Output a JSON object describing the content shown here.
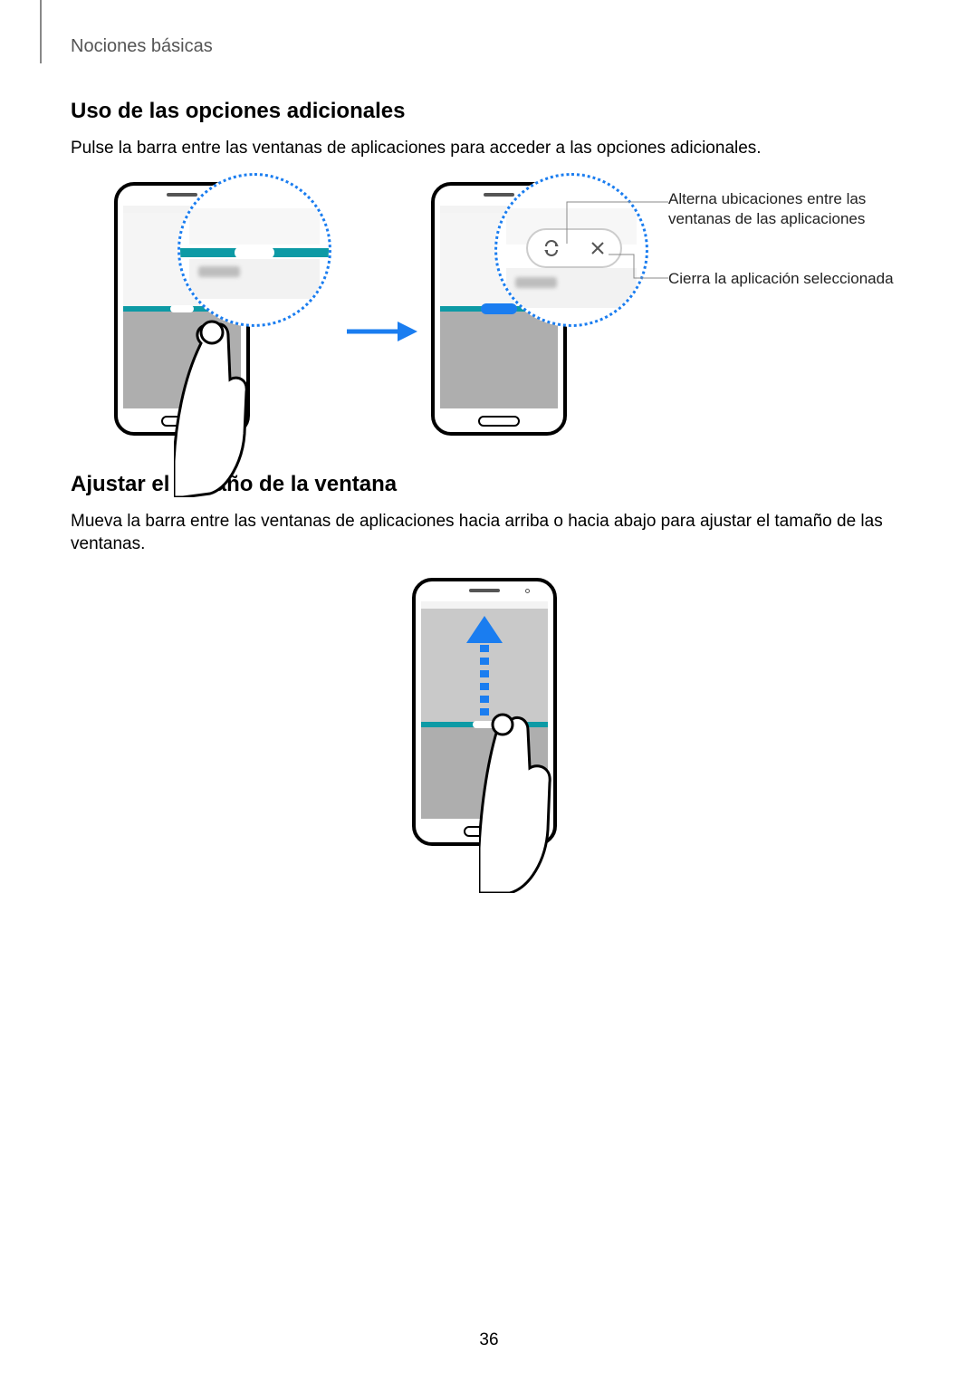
{
  "header": {
    "breadcrumb": "Nociones básicas"
  },
  "section1": {
    "heading": "Uso de las opciones adicionales",
    "body": "Pulse la barra entre las ventanas de aplicaciones para acceder a las opciones adicionales."
  },
  "callouts": {
    "swap": "Alterna ubicaciones entre las ventanas de las aplicaciones",
    "close": "Cierra la aplicación seleccionada"
  },
  "icons": {
    "swap": "swap-icon",
    "close": "close-icon",
    "arrow_right": "arrow-right-icon",
    "arrow_up": "arrow-up-icon"
  },
  "section2": {
    "heading": "Ajustar el tamaño de la ventana",
    "body": "Mueva la barra entre las ventanas de aplicaciones hacia arriba o hacia abajo para ajustar el tamaño de las ventanas."
  },
  "page_number": "36"
}
